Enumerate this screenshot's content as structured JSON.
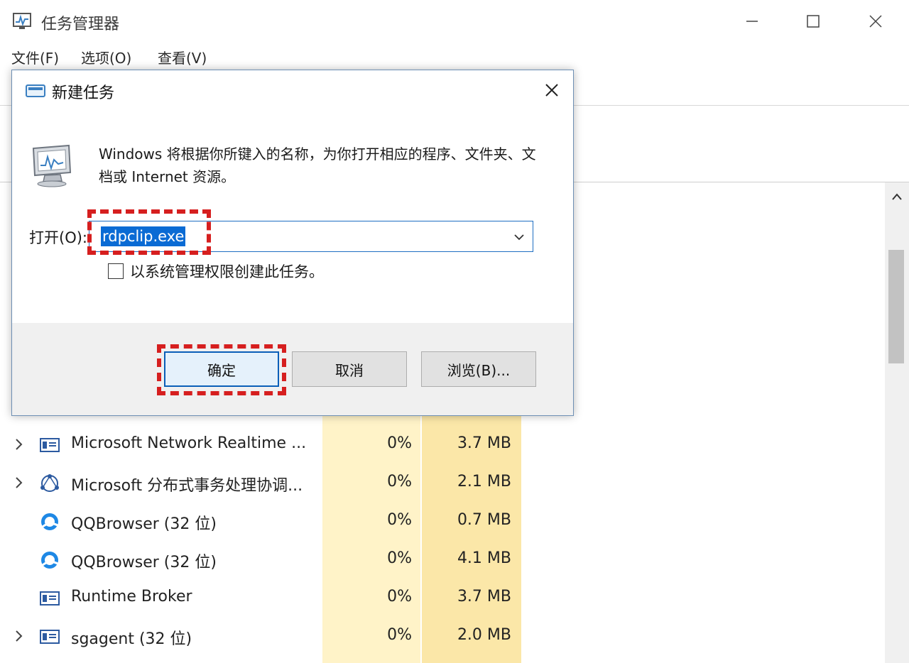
{
  "window": {
    "title": "任务管理器",
    "menu": [
      "文件(F)",
      "选项(O)",
      "查看(V)"
    ]
  },
  "processes": [
    {
      "name": "Microsoft Network Realtime ...",
      "cpu": "0%",
      "memory": "3.7 MB",
      "expandable": true,
      "icon": "service-window-icon"
    },
    {
      "name": "Microsoft 分布式事务处理协调...",
      "cpu": "0%",
      "memory": "2.1 MB",
      "expandable": true,
      "icon": "network-nodes-icon"
    },
    {
      "name": "QQBrowser (32 位)",
      "cpu": "0%",
      "memory": "0.7 MB",
      "expandable": false,
      "icon": "qqbrowser-icon"
    },
    {
      "name": "QQBrowser (32 位)",
      "cpu": "0%",
      "memory": "4.1 MB",
      "expandable": false,
      "icon": "qqbrowser-icon"
    },
    {
      "name": "Runtime Broker",
      "cpu": "0%",
      "memory": "3.7 MB",
      "expandable": false,
      "icon": "service-window-icon"
    },
    {
      "name": "sgagent (32 位)",
      "cpu": "0%",
      "memory": "2.0 MB",
      "expandable": true,
      "icon": "service-window-icon"
    }
  ],
  "dialog": {
    "title": "新建任务",
    "description": "Windows 将根据你所键入的名称，为你打开相应的程序、文件夹、文档或 Internet 资源。",
    "open_label": "打开(O):",
    "open_value": "rdpclip.exe",
    "checkbox_label": "以系统管理权限创建此任务。",
    "checkbox_checked": false,
    "buttons": {
      "ok": "确定",
      "cancel": "取消",
      "browse": "浏览(B)..."
    }
  },
  "colors": {
    "highlight_annotation": "#d61f1f",
    "cpu_column": "#fff3c8",
    "memory_column": "#fbe7a8",
    "selection": "#0a6bd4"
  }
}
